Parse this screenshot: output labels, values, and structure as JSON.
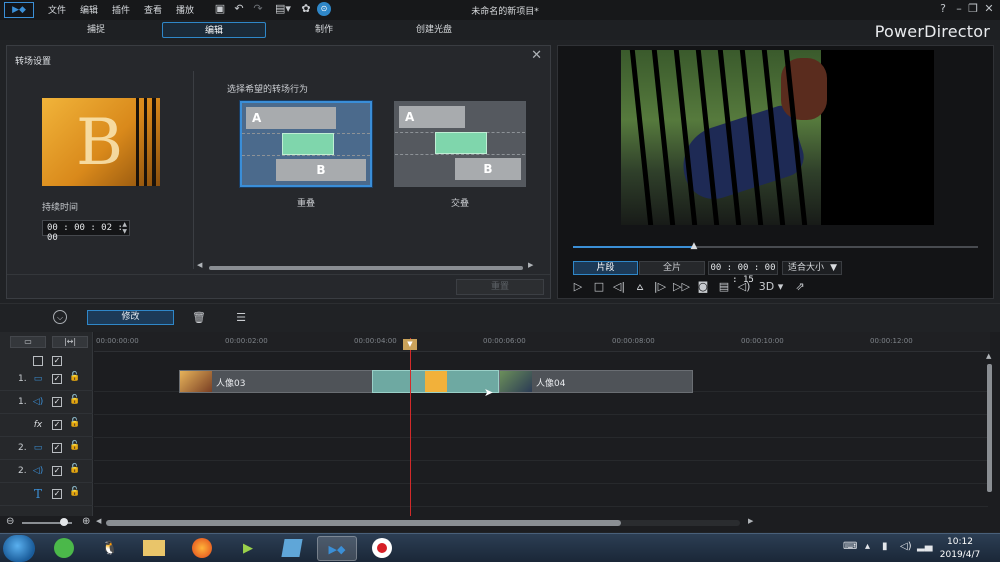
{
  "titlebar": {
    "menus": [
      "文件",
      "编辑",
      "插件",
      "查看",
      "播放"
    ],
    "title": "未命名的新项目*",
    "help": "?"
  },
  "modes": {
    "tabs": [
      "捕捉",
      "编辑",
      "制作",
      "创建光盘"
    ],
    "active": "编辑",
    "brand": "PowerDirector"
  },
  "transition_panel": {
    "title": "转场设置",
    "preview_letter": "B",
    "duration_label": "持续时间",
    "duration_value": "00 : 00 : 02 : 00",
    "behavior_label": "选择希望的转场行为",
    "options": [
      {
        "label": "重叠",
        "a": "A",
        "b": "B",
        "selected": true
      },
      {
        "label": "交叠",
        "a": "A",
        "b": "B",
        "selected": false
      }
    ],
    "reset_label": "重置"
  },
  "player": {
    "mode_clip": "片段",
    "mode_full": "全片",
    "timecode": "00 : 00 : 00 : 15",
    "fit": "适合大小",
    "three_d": "3D",
    "progress": 0.3
  },
  "timeline": {
    "toolbar": {
      "modify_label": "修改"
    },
    "ruler": [
      "00:00:00:00",
      "00:00:02:00",
      "00:00:04:00",
      "00:00:06:00",
      "00:00:08:00",
      "00:00:10:00",
      "00:00:12:00"
    ],
    "tracks": [
      {
        "num": "1.",
        "type": "video-icon"
      },
      {
        "num": "1.",
        "type": "audio-icon"
      },
      {
        "num": "",
        "type": "fx-icon",
        "symbol": "fx"
      },
      {
        "num": "2.",
        "type": "video-icon"
      },
      {
        "num": "2.",
        "type": "audio-icon"
      },
      {
        "num": "",
        "type": "title-icon",
        "symbol": "T"
      }
    ],
    "clips": [
      {
        "label": "人像03"
      },
      {
        "label": "人像04"
      }
    ]
  },
  "taskbar": {
    "time": "10:12",
    "date": "2019/4/7"
  }
}
